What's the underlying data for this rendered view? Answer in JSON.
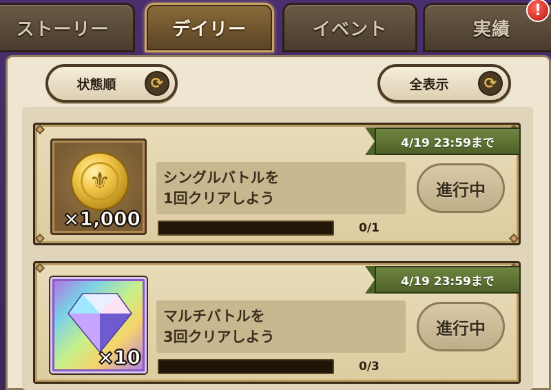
{
  "tabs": [
    {
      "label": "ストーリー",
      "active": false
    },
    {
      "label": "デイリー",
      "active": true
    },
    {
      "label": "イベント",
      "active": false
    },
    {
      "label": "実績",
      "active": false
    }
  ],
  "alert_badge": "!",
  "sort_button": {
    "label": "状態順",
    "icon": "cycle-arrows-icon"
  },
  "filter_button": {
    "label": "全表示",
    "icon": "cycle-arrows-icon"
  },
  "missions": [
    {
      "deadline": "4/19 23:59まで",
      "reward": {
        "icon": "gold-coin-icon",
        "quantity": "×1,000"
      },
      "description": [
        "シングルバトルを",
        "1回クリアしよう"
      ],
      "progress": {
        "current": 0,
        "total": 1,
        "text": "0/1"
      },
      "status": "進行中"
    },
    {
      "deadline": "4/19 23:59まで",
      "reward": {
        "icon": "rainbow-gem-icon",
        "quantity": "×10"
      },
      "description": [
        "マルチバトルを",
        "3回クリアしよう"
      ],
      "progress": {
        "current": 0,
        "total": 3,
        "text": "0/3"
      },
      "status": "進行中"
    }
  ],
  "colors": {
    "panel_bg": "#efe6d1",
    "deadline_ribbon": "#5a6e30",
    "progress_track": "#1f1609"
  }
}
